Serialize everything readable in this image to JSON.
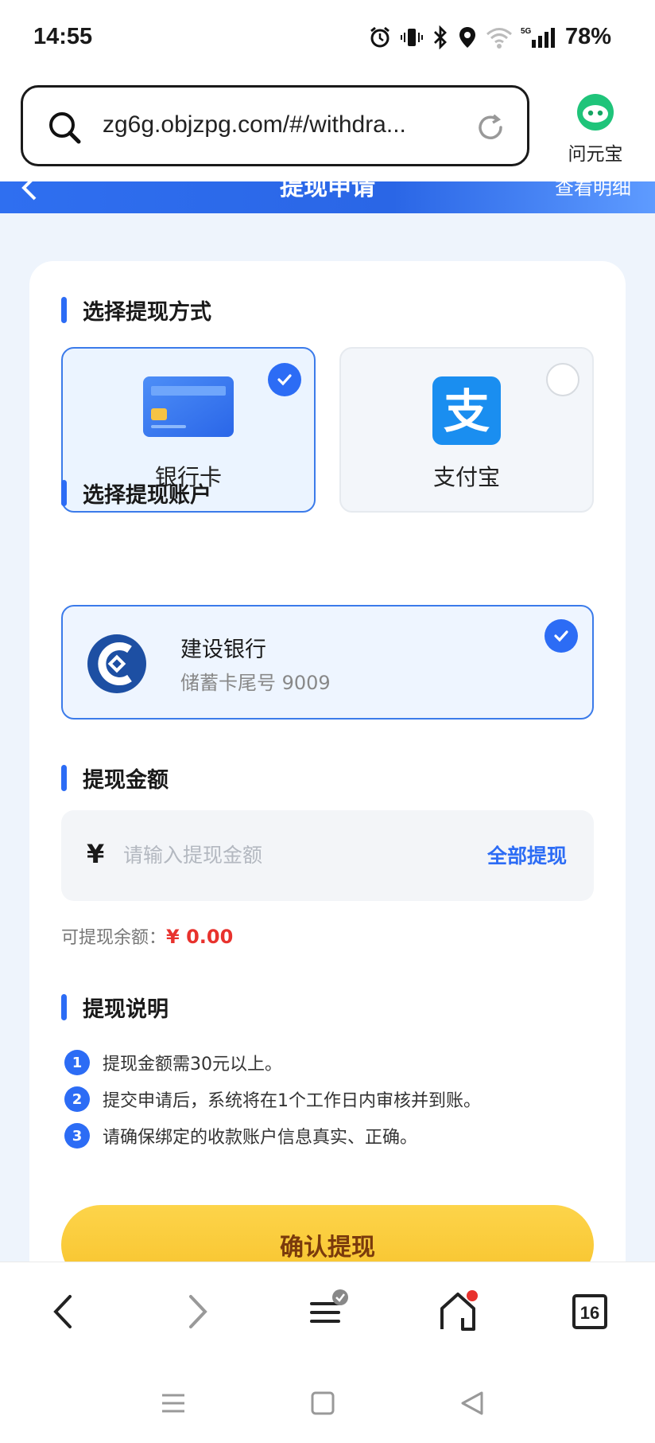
{
  "status": {
    "time": "14:55",
    "network": "5G",
    "battery": "78%"
  },
  "browser": {
    "url": "zg6g.objzpg.com/#/withdra...",
    "assistant_label": "问元宝",
    "tab_count": "16"
  },
  "header": {
    "title": "提现申请",
    "detail_link": "查看明细",
    "accent": "#2c6cf5"
  },
  "method_section": {
    "title": "选择提现方式",
    "options": [
      {
        "label": "银行卡",
        "selected": true
      },
      {
        "label": "支付宝",
        "selected": false
      }
    ]
  },
  "account_section": {
    "title": "选择提现账户",
    "bank_name": "建设银行",
    "card_desc": "储蓄卡尾号 9009"
  },
  "amount_section": {
    "title": "提现金额",
    "currency": "¥",
    "placeholder": "请输入提现金额",
    "value": "",
    "all_label": "全部提现",
    "balance_label": "可提现余额：",
    "balance_value": "¥ 0.00"
  },
  "notes_section": {
    "title": "提现说明",
    "items": [
      {
        "num": "1",
        "text": "提现金额需30元以上。"
      },
      {
        "num": "2",
        "text": "提交申请后，系统将在1个工作日内审核并到账。"
      },
      {
        "num": "3",
        "text": "请确保绑定的收款账户信息真实、正确。"
      }
    ]
  },
  "confirm_label": "确认提现"
}
